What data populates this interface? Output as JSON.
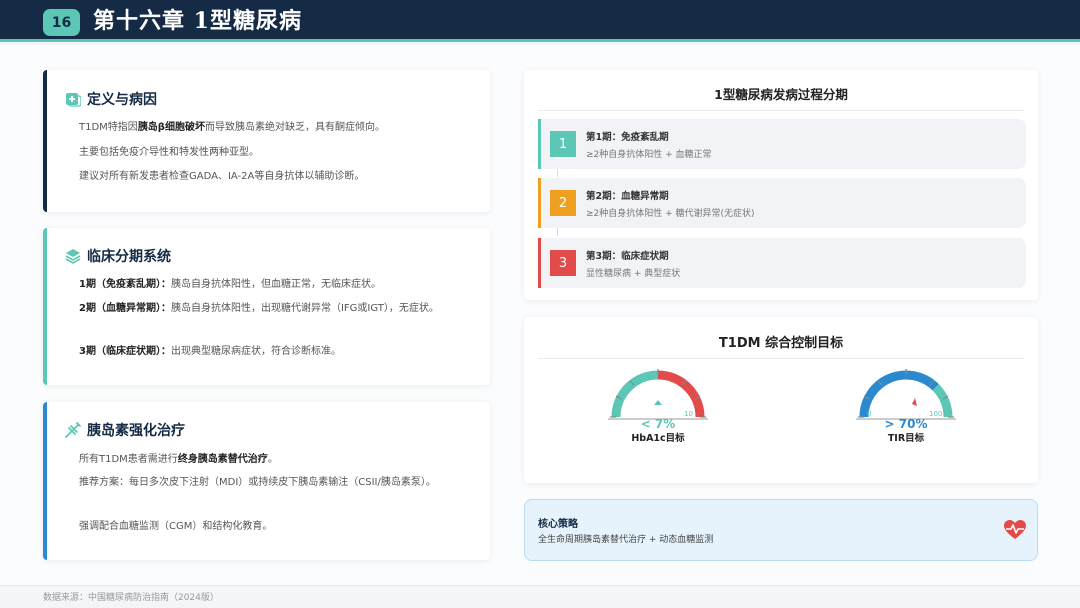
{
  "header": {
    "chapter_number": "16",
    "title": "第十六章 1型糖尿病"
  },
  "colors": {
    "navy": "#142a45",
    "teal": "#5cc7b5",
    "blue": "#2a8ad0",
    "orange": "#f0a020",
    "red": "#e34b4b"
  },
  "definition": {
    "icon": "medical-plus-icon",
    "title": "定义与病因",
    "line1_prefix": "T1DM特指因",
    "line1_bold": "胰岛β细胞破坏",
    "line1_suffix": "而导致胰岛素绝对缺乏，具有酮症倾向。",
    "line2": "主要包括免疫介导性和特发性两种亚型。",
    "line3": "建议对所有新发患者检查GADA、IA-2A等自身抗体以辅助诊断。"
  },
  "staging": {
    "icon": "layers-icon",
    "title": "临床分期系统",
    "items": [
      {
        "label": "1期（免疫紊乱期）：",
        "text": "胰岛自身抗体阳性，但血糖正常，无临床症状。"
      },
      {
        "label": "2期（血糖异常期）：",
        "text": "胰岛自身抗体阳性，出现糖代谢异常（IFG或IGT），无症状。"
      },
      {
        "label": "3期（临床症状期）：",
        "text": "出现典型糖尿病症状，符合诊断标准。"
      }
    ]
  },
  "insulin": {
    "icon": "syringe-icon",
    "title": "胰岛素强化治疗",
    "line1_prefix": "所有T1DM患者需进行",
    "line1_bold": "终身胰岛素替代治疗",
    "line1_suffix": "。",
    "line2": "推荐方案：每日多次皮下注射（MDI）或持续皮下胰岛素输注（CSII/胰岛素泵）。",
    "line3": "强调配合血糖监测（CGM）和结构化教育。"
  },
  "stages_panel": {
    "title": "1型糖尿病发病过程分期",
    "steps": [
      {
        "num": "1",
        "title": "第1期：免疫紊乱期",
        "desc": "≥2种自身抗体阳性 + 血糖正常",
        "color": "#5cc7b5"
      },
      {
        "num": "2",
        "title": "第2期：血糖异常期",
        "desc": "≥2种自身抗体阳性 + 糖代谢异常(无症状)",
        "color": "#f0a020"
      },
      {
        "num": "3",
        "title": "第3期：临床症状期",
        "desc": "显性糖尿病 + 典型症状",
        "color": "#e34b4b"
      }
    ]
  },
  "targets": {
    "title": "T1DM 综合控制目标",
    "gauges": [
      {
        "value": "< 7%",
        "label": "HbA1c目标",
        "tick_max": "10",
        "level": 0.7
      },
      {
        "value": "> 70%",
        "label": "TIR目标",
        "tick_min": "0",
        "tick_max": "100",
        "level": 0.7
      }
    ]
  },
  "strategy": {
    "title": "核心策略",
    "text": "全生命周期胰岛素替代治疗 + 动态血糖监测",
    "icon": "heart-pulse-icon"
  },
  "footer": {
    "source": "数据来源：中国糖尿病防治指南（2024版）"
  }
}
